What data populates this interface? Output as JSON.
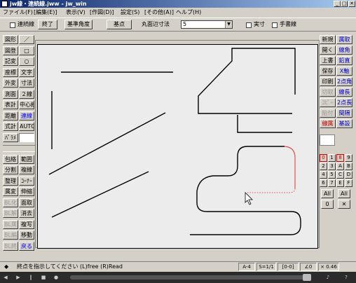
{
  "window": {
    "title": "jw線・連続線.jww - jw_win"
  },
  "menu": [
    "ファイル(F)",
    "[編集(E)]",
    "表示(V)",
    "[作図(D)]",
    "設定(S)",
    "[その他(A)]",
    "ヘルプ(H)"
  ],
  "toolbar": {
    "renzoku_label": "連続線",
    "end_label": "終了",
    "base_angle_label": "基準角度",
    "base_point_label": "基点",
    "round_label": "丸面辺寸法",
    "round_value": "5",
    "jissun_label": "実寸",
    "tegaki_label": "手書線"
  },
  "left_tools": [
    [
      "図形",
      "／"
    ],
    [
      "図登",
      "□"
    ],
    [
      "記変",
      "○"
    ],
    [
      "座標",
      "文字"
    ],
    [
      "外変",
      "寸法"
    ],
    [
      "測面",
      "２線"
    ],
    [
      "表計",
      "中心線"
    ],
    [
      "距離",
      "連線"
    ],
    [
      "式計",
      "AUTO"
    ],
    [
      "ﾊﾟﾗﾒ",
      ""
    ],
    [
      "",
      ""
    ],
    [
      "包絡",
      "範囲"
    ],
    [
      "分割",
      "複線"
    ],
    [
      "整理",
      "ｺｰﾅｰ"
    ],
    [
      "属変",
      "伸縮"
    ],
    [
      "BL化",
      "面取"
    ],
    [
      "BL解",
      "消去"
    ],
    [
      "BL属",
      "複写"
    ],
    [
      "BL編",
      "移動"
    ],
    [
      "BL終",
      "戻る"
    ]
  ],
  "right_tools": [
    [
      "新規",
      "属取"
    ],
    [
      "開く",
      "線角"
    ],
    [
      "上書",
      "鉛直"
    ],
    [
      "保存",
      "X軸"
    ],
    [
      "印刷",
      "2点角"
    ],
    [
      "切取",
      "線長"
    ],
    [
      "ｺﾋﾟｰ",
      "2点長"
    ],
    [
      "貼付",
      "間隔"
    ],
    [
      "線属",
      "基設"
    ]
  ],
  "layers": {
    "groups": [
      "0",
      "1",
      "2",
      "3",
      "4",
      "5",
      "6",
      "7"
    ],
    "sub": [
      "8",
      "9",
      "A",
      "B",
      "C",
      "D",
      "E",
      "F"
    ],
    "all_label": "All",
    "x_label": "✕",
    "zero_label": "0"
  },
  "status": {
    "message": "終点を指示してください (L)free (R)Read",
    "paper": "A-4",
    "scale": "S=1/1",
    "layer": "[0-0]",
    "angle": "∠0",
    "zoom": "× 0.46"
  }
}
